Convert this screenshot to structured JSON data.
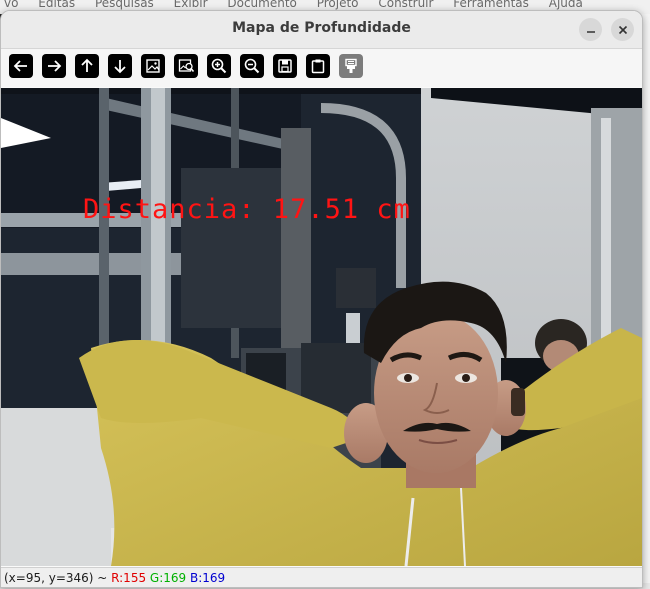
{
  "background_app": {
    "menu_items": [
      "vo",
      "Editas",
      "Pesquisas",
      "Exibir",
      "Documento",
      "Projeto",
      "Construir",
      "Ferramentas",
      "Ajuda"
    ]
  },
  "window": {
    "title": "Mapa de Profundidade"
  },
  "toolbar": {
    "tools": [
      {
        "name": "pan-left-icon"
      },
      {
        "name": "pan-right-icon"
      },
      {
        "name": "pan-up-icon"
      },
      {
        "name": "pan-down-icon"
      },
      {
        "name": "zoom-image-icon"
      },
      {
        "name": "zoom-region-icon"
      },
      {
        "name": "zoom-in-icon"
      },
      {
        "name": "zoom-out-icon"
      },
      {
        "name": "save-image-icon"
      },
      {
        "name": "copy-clipboard-icon"
      },
      {
        "name": "properties-icon"
      }
    ]
  },
  "overlay": {
    "distance_text": "Distancia: 17.51 cm"
  },
  "status": {
    "coords": "(x=95, y=346) ~ ",
    "r": "R:155",
    "g": "G:169",
    "b": "B:169"
  },
  "colors": {
    "overlay_text": "#ff1414",
    "shirt": "#c9b548",
    "titlebar": "#ebebeb"
  }
}
